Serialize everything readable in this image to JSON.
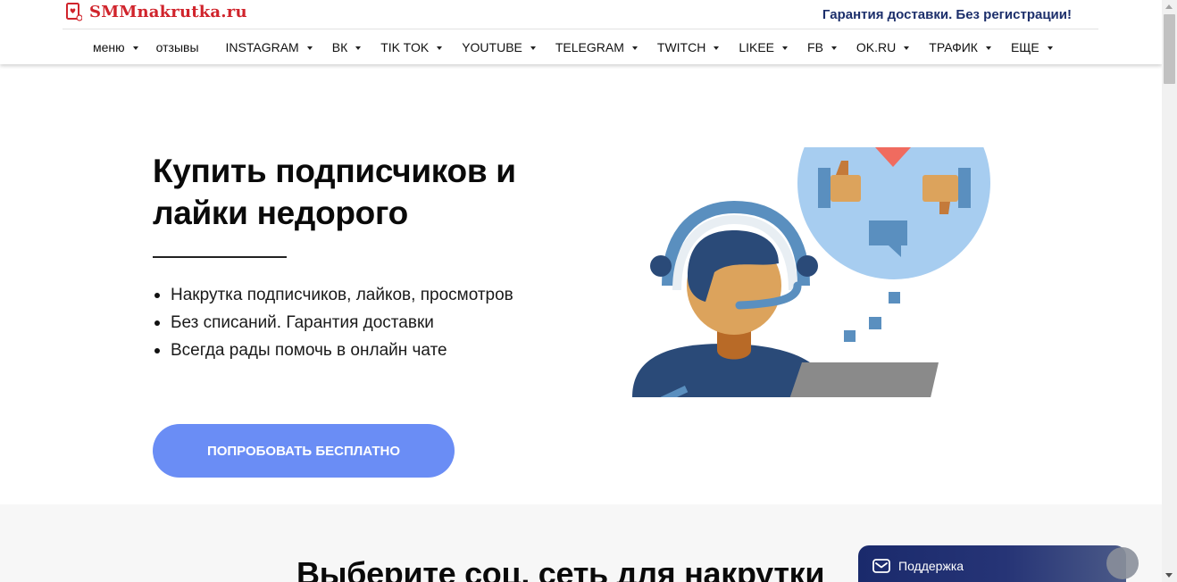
{
  "header": {
    "logo_text": "SMMnakrutka.ru",
    "tagline": "Гарантия доставки. Без регистрации!"
  },
  "nav": {
    "items": [
      {
        "label": "меню",
        "dropdown": true
      },
      {
        "label": "отзывы",
        "dropdown": false
      },
      {
        "label": "INSTAGRAM",
        "dropdown": true
      },
      {
        "label": "ВК",
        "dropdown": true
      },
      {
        "label": "TIK TOK",
        "dropdown": true
      },
      {
        "label": "YOUTUBE",
        "dropdown": true
      },
      {
        "label": "TELEGRAM",
        "dropdown": true
      },
      {
        "label": "TWITCH",
        "dropdown": true
      },
      {
        "label": "LIKEE",
        "dropdown": true
      },
      {
        "label": "FB",
        "dropdown": true
      },
      {
        "label": "OK.RU",
        "dropdown": true
      },
      {
        "label": "ТРАФИК",
        "dropdown": true
      },
      {
        "label": "ЕЩЕ",
        "dropdown": true
      }
    ]
  },
  "hero": {
    "title": "Купить подписчиков и лайки недорого",
    "bullets": [
      "Накрутка подписчиков, лайков, просмотров",
      "Без списаний. Гарантия доставки",
      "Всегда рады помочь в онлайн чате"
    ],
    "cta_label": "ПОПРОБОВАТЬ БЕСПЛАТНО"
  },
  "section2": {
    "title": "Выберите соц. сеть для накрутки"
  },
  "support": {
    "label": "Поддержка"
  },
  "icons": {
    "logo": "heart-card-icon",
    "support": "mail-icon",
    "illustration": "support-operator-illustration"
  },
  "colors": {
    "brand_red": "#d0242c",
    "tagline_navy": "#1c2f6b",
    "cta_blue": "#6a8df5",
    "support_navy": "#1a2a6c"
  }
}
